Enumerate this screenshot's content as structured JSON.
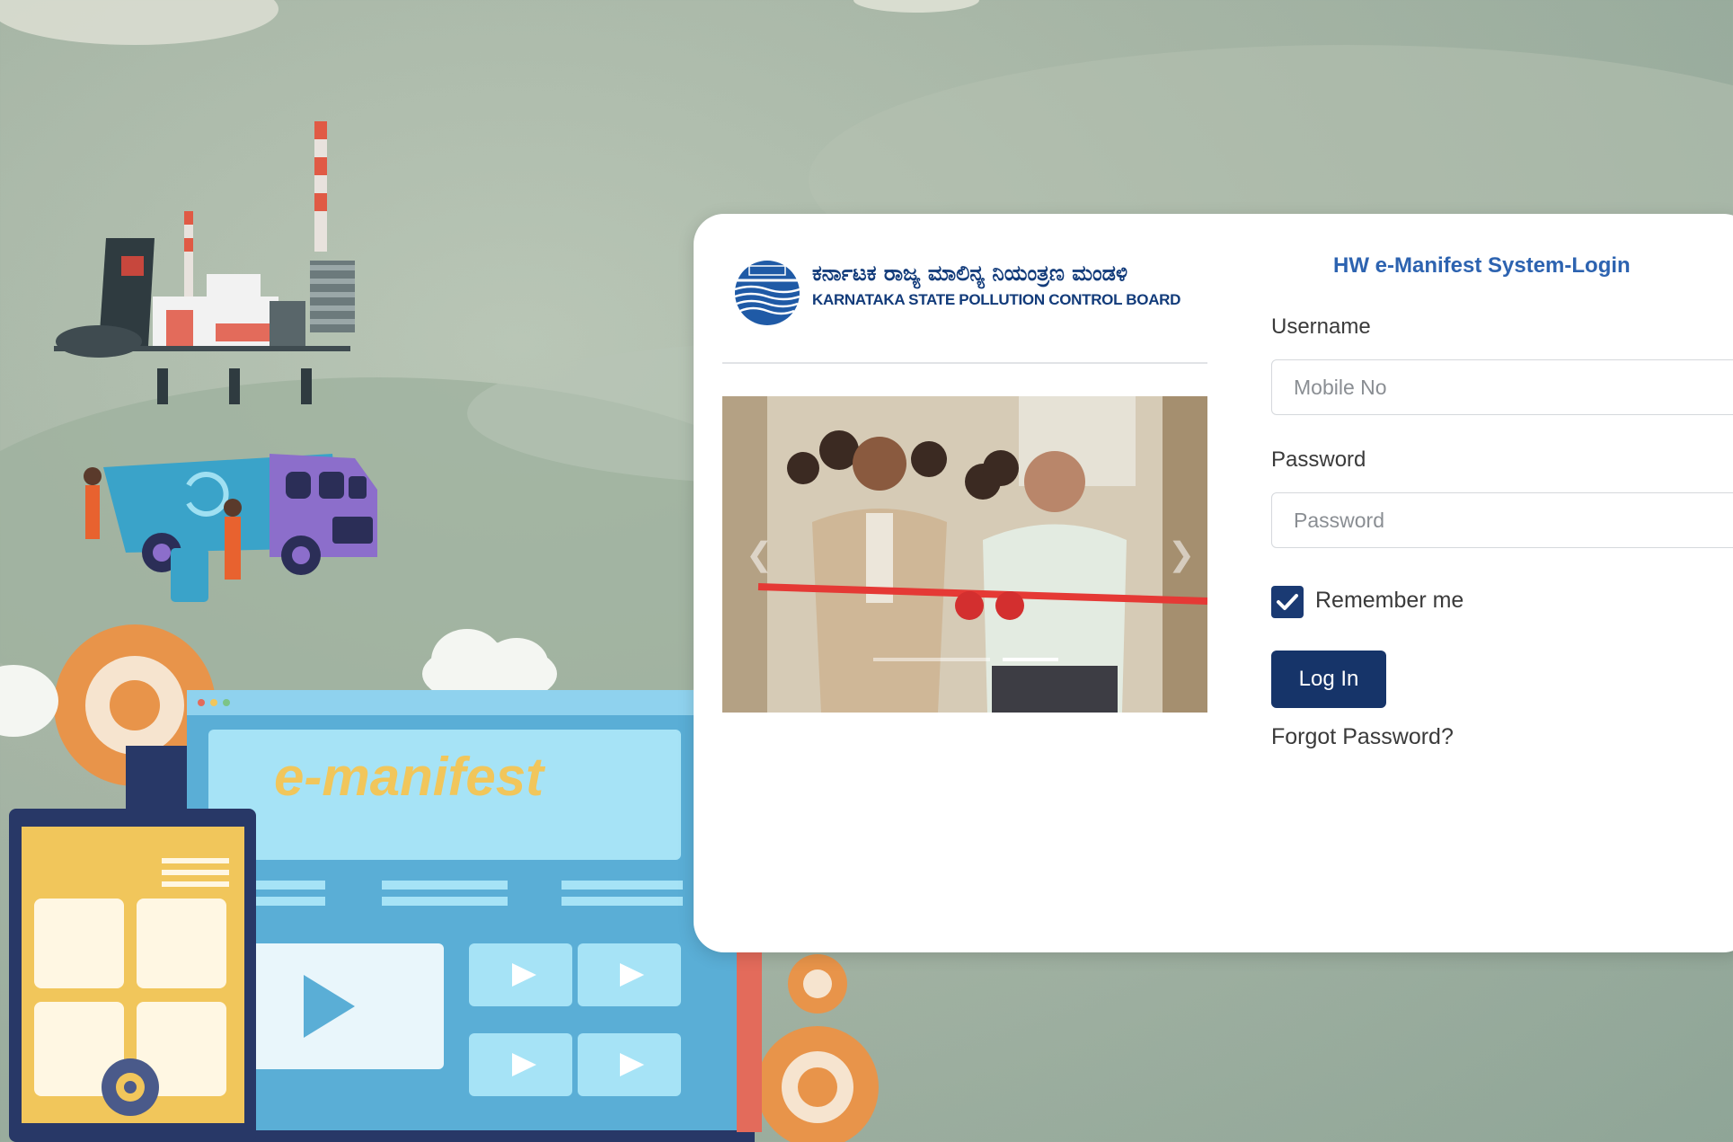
{
  "org": {
    "name_kannada": "ಕರ್ನಾಟಕ ರಾಜ್ಯ ಮಾಲಿನ್ಯ ನಿಯಂತ್ರಣ ಮಂಡಳಿ",
    "name_english": "KARNATAKA STATE POLLUTION CONTROL BOARD"
  },
  "illustration": {
    "screen_title": "e-manifest"
  },
  "login": {
    "title": "HW e-Manifest System-Login",
    "username_label": "Username",
    "username_placeholder": "Mobile No",
    "password_label": "Password",
    "password_placeholder": "Password",
    "remember_label": "Remember me",
    "remember_checked": true,
    "login_button": "Log In",
    "forgot_link": "Forgot Password?"
  },
  "carousel": {
    "indicator_count": 2,
    "active_index": 1
  },
  "colors": {
    "brand_navy": "#163469",
    "title_blue": "#2d63b0",
    "accent_orange": "#e8944a",
    "bg_sage": "#a6b5a5"
  }
}
